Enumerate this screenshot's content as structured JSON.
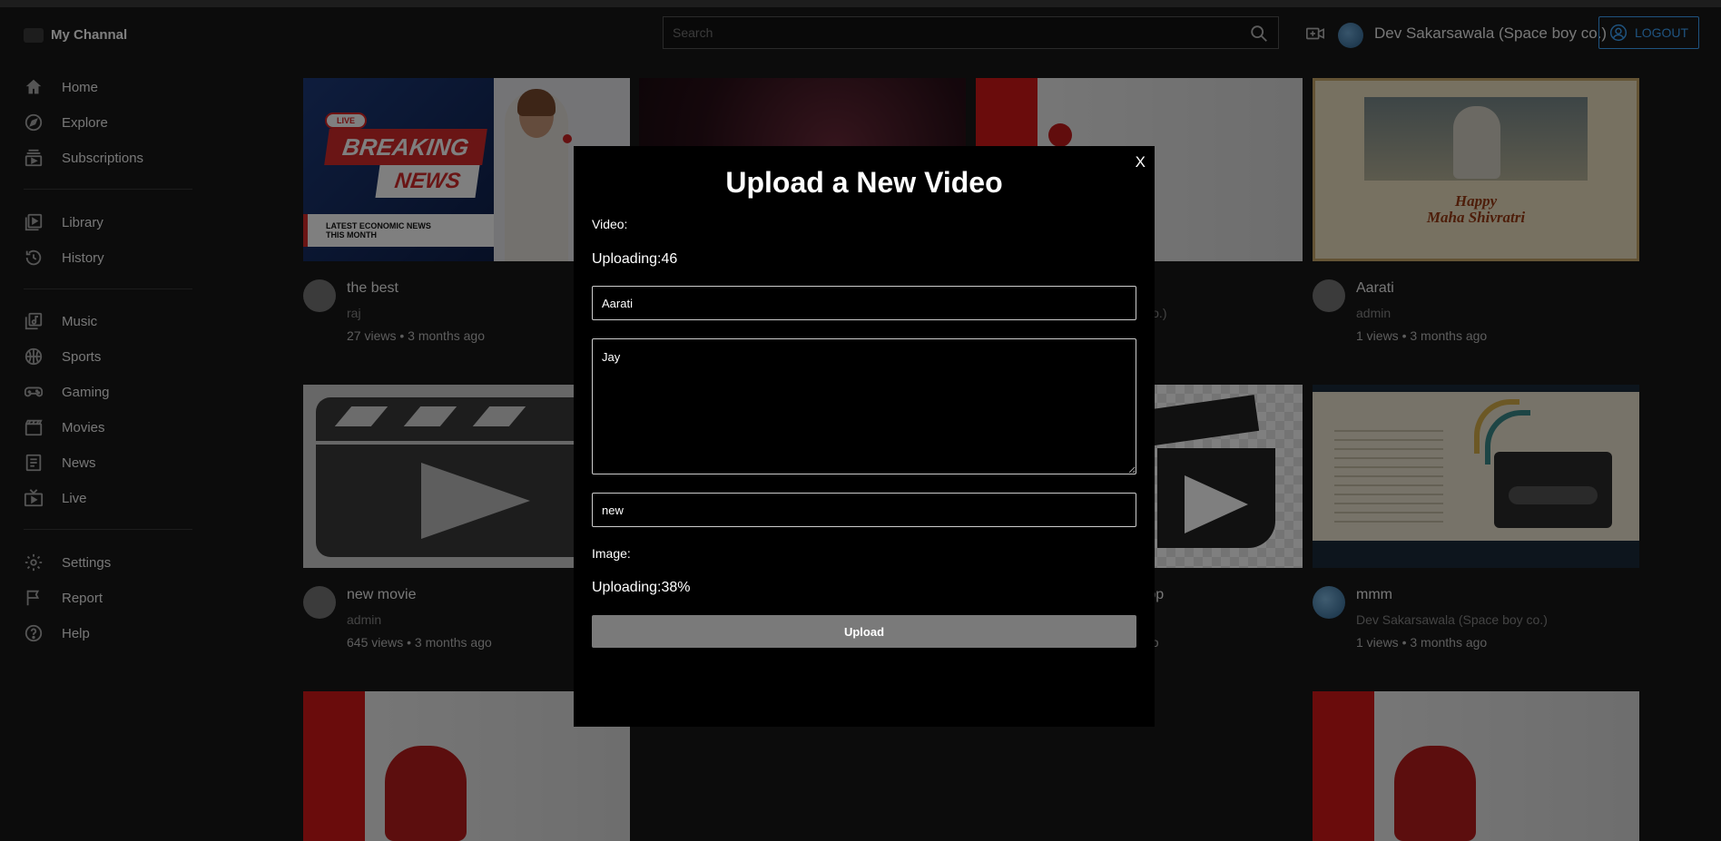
{
  "header": {
    "channel_name": "My Channal",
    "search_placeholder": "Search",
    "user_name": "Dev Sakarsawala (Space boy co.)",
    "logout_label": "LOGOUT"
  },
  "sidebar": {
    "items": [
      {
        "label": "Home",
        "icon": "home-icon"
      },
      {
        "label": "Explore",
        "icon": "compass-icon"
      },
      {
        "label": "Subscriptions",
        "icon": "subscriptions-icon"
      },
      {
        "label": "Library",
        "icon": "library-icon"
      },
      {
        "label": "History",
        "icon": "history-icon"
      },
      {
        "label": "Music",
        "icon": "music-icon"
      },
      {
        "label": "Sports",
        "icon": "sports-icon"
      },
      {
        "label": "Gaming",
        "icon": "gaming-icon"
      },
      {
        "label": "Movies",
        "icon": "movies-icon"
      },
      {
        "label": "News",
        "icon": "news-icon"
      },
      {
        "label": "Live",
        "icon": "live-icon"
      },
      {
        "label": "Settings",
        "icon": "gear-icon"
      },
      {
        "label": "Report",
        "icon": "flag-icon"
      },
      {
        "label": "Help",
        "icon": "help-icon"
      }
    ]
  },
  "thumbnails": {
    "breaking_line1": "BREAKING",
    "breaking_line2": "NEWS",
    "breaking_sub": "LATEST ECONOMIC NEWS THIS MONTH",
    "live_label": "LIVE",
    "shiv_line1": "Happy",
    "shiv_line2": "Maha Shivratri"
  },
  "videos": [
    {
      "title": "the best",
      "channel": "raj",
      "stats": "27 views • 3 months ago"
    },
    {
      "title": "Aarati",
      "channel": "admin",
      "stats": "1 views • 3 months ago"
    },
    {
      "title": "new movie",
      "channel": "admin",
      "stats": "645 views • 3 months ago"
    },
    {
      "title": "mmm",
      "channel": "Dev Sakarsawala (Space boy co.)",
      "stats": "1 views • 3 months ago"
    }
  ],
  "partial_cards": {
    "card3_channel_fragment": "e boy co.)",
    "card3_stats_fragment": "o",
    "card7_title_fragment": "s app",
    "card7_stats_fragment": "go"
  },
  "modal": {
    "title": "Upload a New Video",
    "close_label": "X",
    "video_label": "Video:",
    "video_progress": "Uploading:46",
    "title_value": "Aarati",
    "description_value": "Jay",
    "tags_value": "new",
    "image_label": "Image:",
    "image_progress": "Uploading:38%",
    "upload_label": "Upload"
  }
}
